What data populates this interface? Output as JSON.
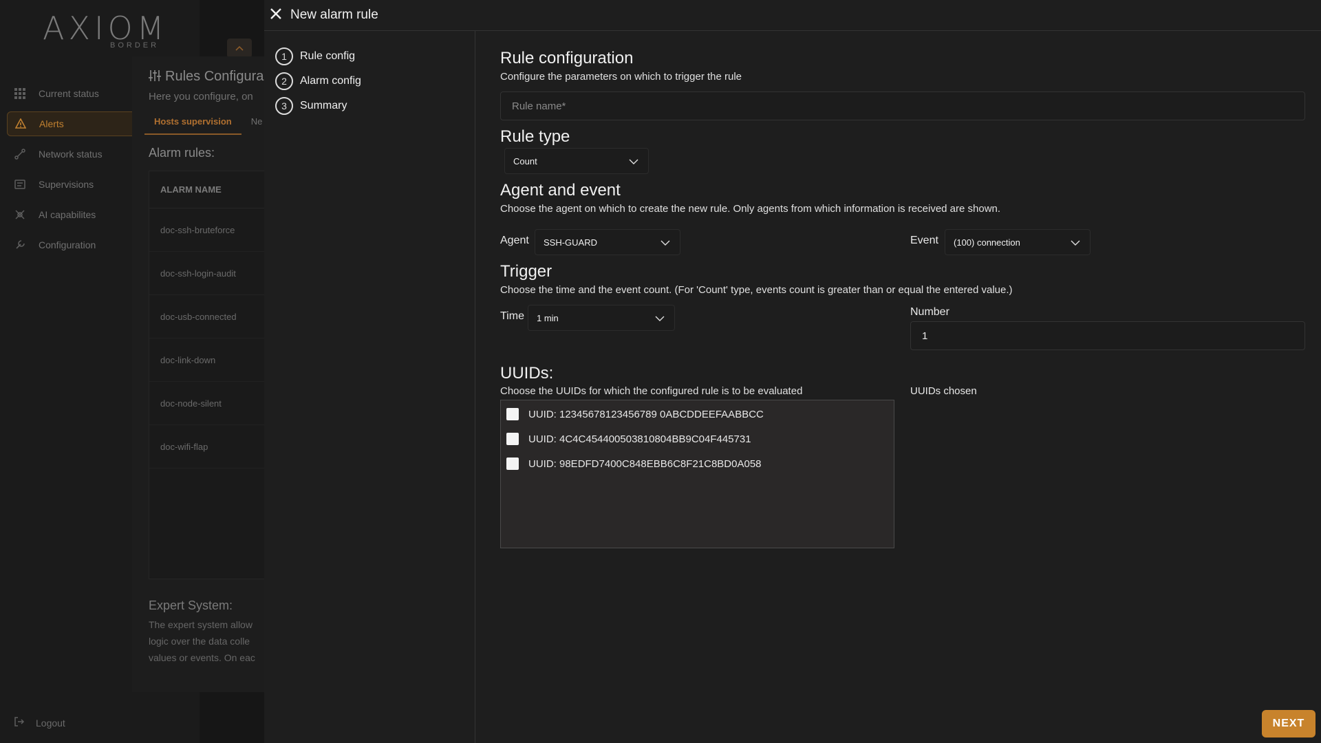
{
  "background": {
    "logo": "AXIOM",
    "logo_sub": "BORDER",
    "nav": [
      {
        "label": "Current status",
        "icon": "grid-icon"
      },
      {
        "label": "Alerts",
        "icon": "warning-icon",
        "active": true
      },
      {
        "label": "Network status",
        "icon": "network-icon"
      },
      {
        "label": "Supervisions",
        "icon": "supervision-icon"
      },
      {
        "label": "AI capabilites",
        "icon": "ai-icon"
      },
      {
        "label": "Configuration",
        "icon": "wrench-icon"
      }
    ],
    "logout_label": "Logout",
    "rules_title": "Rules Configura",
    "rules_subtitle": "Here you configure, on",
    "tabs": [
      "Hosts supervision",
      "Ne"
    ],
    "alarm_rules_label": "Alarm rules:",
    "alarm_table_header": "ALARM NAME",
    "alarm_rows": [
      "doc-ssh-bruteforce",
      "doc-ssh-login-audit",
      "doc-usb-connected",
      "doc-link-down",
      "doc-node-silent",
      "doc-wifi-flap"
    ],
    "expert_title": "Expert System:",
    "expert_lines": [
      "The expert system allow",
      "logic over the data colle",
      "values or events. On eac"
    ]
  },
  "modal": {
    "title": "New alarm rule",
    "steps": [
      {
        "num": "1",
        "label": "Rule config"
      },
      {
        "num": "2",
        "label": "Alarm config"
      },
      {
        "num": "3",
        "label": "Summary"
      }
    ],
    "rule_config": {
      "title": "Rule configuration",
      "description": "Configure the parameters on which to trigger the rule",
      "name_placeholder": "Rule name*"
    },
    "rule_type": {
      "title": "Rule type",
      "value": "Count"
    },
    "agent_event": {
      "title": "Agent and event",
      "description": "Choose the agent on which to create the new rule. Only agents from which information is received are shown.",
      "agent_label": "Agent",
      "agent_value": "SSH-GUARD",
      "event_label": "Event",
      "event_value": "(100) connection"
    },
    "trigger": {
      "title": "Trigger",
      "description": "Choose the time and the event count. (For 'Count' type, events count is greater than or equal the entered value.)",
      "time_label": "Time",
      "time_value": "1 min",
      "number_label": "Number",
      "number_value": "1"
    },
    "uuids": {
      "title": "UUIDs:",
      "description": "Choose the UUIDs for which the configured rule is to be evaluated",
      "chosen_label": "UUIDs chosen",
      "items": [
        "UUID: 12345678123456789 0ABCDDEEFAABBCC",
        "UUID: 4C4C454400503810804BB9C04F445731",
        "UUID: 98EDFD7400C848EBB6C8F21C8BD0A058"
      ]
    },
    "next_label": "NEXT"
  },
  "colors": {
    "accent": "#c8832c",
    "modal_bg": "#1e1e1e",
    "page_bg": "#141414"
  }
}
